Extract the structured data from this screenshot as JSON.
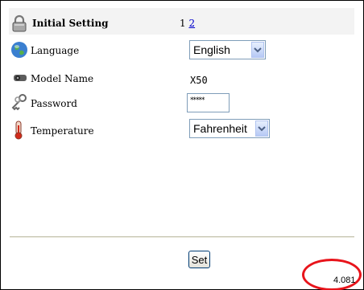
{
  "header": {
    "title": "Initial Setting",
    "page_1": "1",
    "page_2": "2"
  },
  "rows": {
    "language": {
      "label": "Language",
      "value": "English"
    },
    "model": {
      "label": "Model Name",
      "value": "X50"
    },
    "password": {
      "label": "Password",
      "value": "*****"
    },
    "temperature": {
      "label": "Temperature",
      "value": "Fahrenheit"
    }
  },
  "actions": {
    "set_label": "Set"
  },
  "footer": {
    "version": "4.081"
  },
  "colors": {
    "link": "#0000cc",
    "annotation": "#e8141b",
    "header_bg": "#f3f3f3"
  },
  "icons": [
    "lock-icon",
    "globe-icon",
    "projector-icon",
    "keys-icon",
    "thermometer-icon",
    "chevron-down-icon"
  ]
}
